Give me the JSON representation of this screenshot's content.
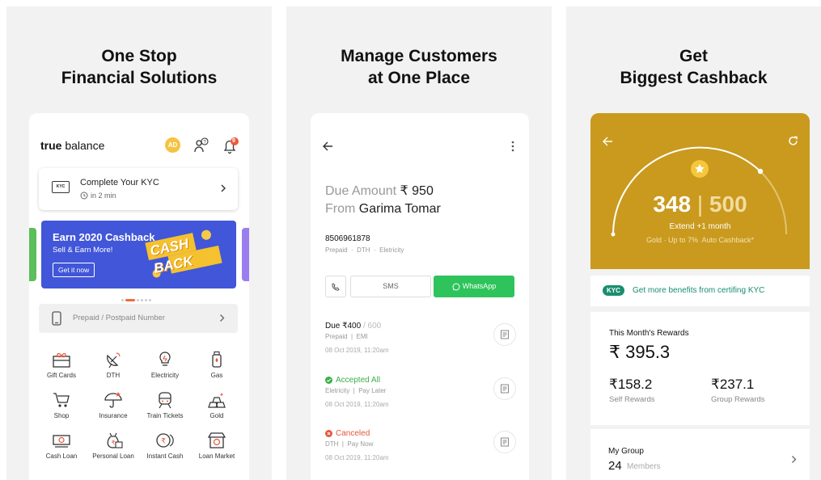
{
  "panel1": {
    "headline": [
      "One Stop",
      "Financial Solutions"
    ],
    "brand": {
      "bold": "true",
      "rest": " balance"
    },
    "avatar": "AD",
    "notification_count": "9",
    "kyc": {
      "badge": "KYC",
      "title": "Complete Your KYC",
      "time": "in 2 min"
    },
    "banner": {
      "title": "Earn 2020 Cashback",
      "subtitle": "Sell & Earn More!",
      "cta": "Get it now",
      "art": "CASH BACK"
    },
    "phone_placeholder": "Prepaid / Postpaid Number",
    "services": [
      {
        "label": "Gift Cards",
        "icon": "gift-card-icon"
      },
      {
        "label": "DTH",
        "icon": "dth-dish-icon"
      },
      {
        "label": "Electricity",
        "icon": "bulb-icon"
      },
      {
        "label": "Gas",
        "icon": "gas-cylinder-icon"
      },
      {
        "label": "Shop",
        "icon": "cart-icon"
      },
      {
        "label": "Insurance",
        "icon": "umbrella-icon"
      },
      {
        "label": "Train Tickets",
        "icon": "train-icon"
      },
      {
        "label": "Gold",
        "icon": "gold-bars-icon"
      },
      {
        "label": "Cash Loan",
        "icon": "cash-icon"
      },
      {
        "label": "Personal Loan",
        "icon": "money-bag-icon"
      },
      {
        "label": "Instant Cash",
        "icon": "coins-icon"
      },
      {
        "label": "Loan Market",
        "icon": "market-icon"
      }
    ]
  },
  "panel2": {
    "headline": [
      "Manage Customers",
      "at One Place"
    ],
    "due_label": "Due Amount",
    "due_amount": "₹ 950",
    "from_label": "From",
    "customer": "Garima Tomar",
    "phone": "8506961878",
    "tags": "Prepaid  ·  DTH  ·  Eletricity",
    "sms": "SMS",
    "whatsapp": "WhatsApp",
    "transactions": [
      {
        "title": "Due ₹400",
        "extra": " / 600",
        "meta": "Prepaid  |  EMI",
        "date": "08 Oct 2019, 11:20am",
        "status": ""
      },
      {
        "title": "Accepted All",
        "extra": "",
        "meta": "Eletricity  |  Pay Later",
        "date": "08 Oct 2019, 11:20am",
        "status": "ok"
      },
      {
        "title": "Canceled",
        "extra": "",
        "meta": "DTH  |  Pay Now",
        "date": "08 Oct 2019, 11:20am",
        "status": "no"
      }
    ]
  },
  "panel3": {
    "headline": [
      "Get",
      "Biggest Cashback"
    ],
    "score": "348",
    "score_max": "500",
    "extend": "Extend +1 month",
    "auto": "Gold · Up to 7%  Auto Cashback*",
    "kyc_tag": "KYC",
    "kyc_text": "Get more benefits from certifing KYC",
    "rewards_title": "This Month's Rewards",
    "rewards_value": "₹ 395.3",
    "self_value": "₹158.2",
    "self_label": "Self Rewards",
    "group_value": "₹237.1",
    "group_label": "Group Rewards",
    "group_title": "My Group",
    "group_count": "24",
    "group_unit": "Members"
  },
  "colors": {
    "accent_green": "#2ec45b",
    "gold": "#c99a1e",
    "banner_blue": "#4156d8",
    "kyc_green": "#178e6f"
  }
}
